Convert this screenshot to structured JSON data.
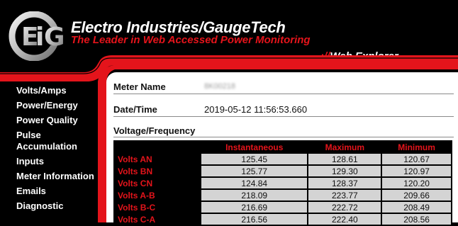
{
  "header": {
    "brand_title": "Electro Industries/GaugeTech",
    "brand_tagline": "The Leader in Web Accessed Power Monitoring",
    "product_prefix": "://",
    "product_name": "Web Explorer",
    "logo_letters": "EIG"
  },
  "sidebar": {
    "items": [
      {
        "label": "Volts/Amps"
      },
      {
        "label": "Power/Energy"
      },
      {
        "label": "Power Quality"
      },
      {
        "label": "Pulse Accumulation"
      },
      {
        "label": "Inputs"
      },
      {
        "label": "Meter Information"
      },
      {
        "label": "Emails"
      },
      {
        "label": "Diagnostic"
      }
    ]
  },
  "main": {
    "meter_name_label": "Meter Name",
    "meter_name_value": "8K00218",
    "datetime_label": "Date/Time",
    "datetime_value": "2019-05-12 11:56:53.660",
    "section_title": "Voltage/Frequency",
    "table": {
      "headers": [
        "Instantaneous",
        "Maximum",
        "Minimum"
      ],
      "rows": [
        {
          "label": "Volts AN",
          "values": [
            "125.45",
            "128.61",
            "120.67"
          ]
        },
        {
          "label": "Volts BN",
          "values": [
            "125.77",
            "129.30",
            "120.97"
          ]
        },
        {
          "label": "Volts CN",
          "values": [
            "124.84",
            "128.37",
            "120.20"
          ]
        },
        {
          "label": "Volts A-B",
          "values": [
            "218.09",
            "223.77",
            "209.66"
          ]
        },
        {
          "label": "Volts B-C",
          "values": [
            "216.69",
            "222.72",
            "208.49"
          ]
        },
        {
          "label": "Volts C-A",
          "values": [
            "216.56",
            "222.40",
            "208.56"
          ]
        }
      ]
    }
  },
  "colors": {
    "accent_red": "#e4141b",
    "background": "#000000",
    "cell_gray": "#d4d4d4"
  }
}
